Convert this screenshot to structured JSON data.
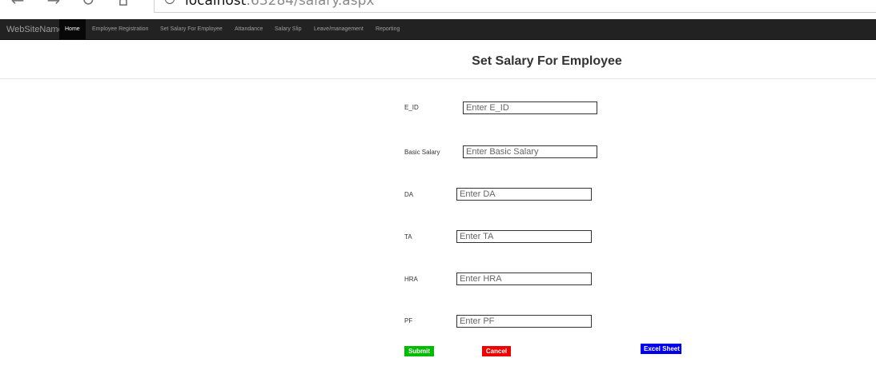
{
  "browser": {
    "url_host": "localhost",
    "url_rest": ":63284/salary.aspx"
  },
  "navbar": {
    "brand": "WebSiteName",
    "items": [
      {
        "label": "Home",
        "active": true
      },
      {
        "label": "Employee Registration",
        "active": false
      },
      {
        "label": "Set Salary For Employee",
        "active": false
      },
      {
        "label": "Attandance",
        "active": false
      },
      {
        "label": "Salary Slip",
        "active": false
      },
      {
        "label": "Leave/management",
        "active": false
      },
      {
        "label": "Reporting",
        "active": false
      }
    ]
  },
  "page": {
    "title": "Set Salary For Employee"
  },
  "form": {
    "fields": [
      {
        "label": "E_ID",
        "value": "",
        "placeholder": "Enter E_ID"
      },
      {
        "label": "Basic Salary",
        "value": "",
        "placeholder": "Enter Basic Salary"
      },
      {
        "label": "DA",
        "value": "",
        "placeholder": "Enter DA"
      },
      {
        "label": "TA",
        "value": "",
        "placeholder": "Enter TA"
      },
      {
        "label": "HRA",
        "value": "",
        "placeholder": "Enter HRA"
      },
      {
        "label": "PF",
        "value": "",
        "placeholder": "Enter PF"
      }
    ],
    "buttons": {
      "submit": "Submit",
      "cancel": "Cancel",
      "excel": "Excel Sheet"
    }
  },
  "colors": {
    "navbar_bg": "#222222",
    "submit": "#00bb00",
    "cancel": "#ee0000",
    "excel": "#0000ee"
  }
}
